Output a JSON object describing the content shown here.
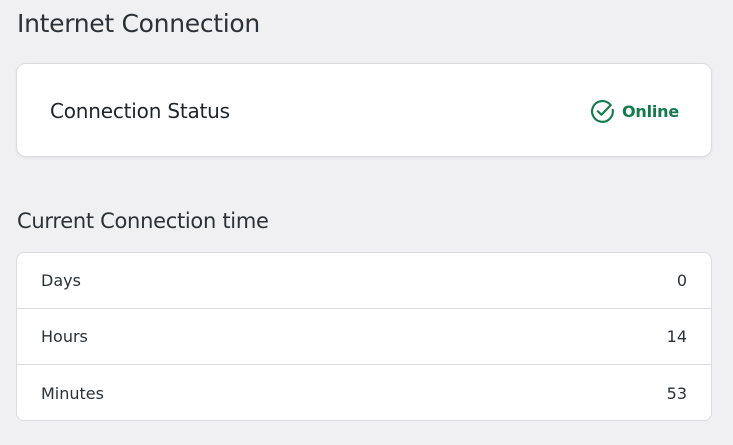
{
  "page": {
    "title": "Internet Connection"
  },
  "status_card": {
    "label": "Connection Status",
    "status_text": "Online",
    "status_icon": "check-circle-icon",
    "status_color": "#137a4c"
  },
  "connection_time": {
    "title": "Current Connection time",
    "rows": [
      {
        "label": "Days",
        "value": "0"
      },
      {
        "label": "Hours",
        "value": "14"
      },
      {
        "label": "Minutes",
        "value": "53"
      }
    ]
  },
  "colors": {
    "background": "#f0f0f2",
    "card": "#ffffff",
    "border": "#dcdce0",
    "text": "#2b3136",
    "online": "#137a4c"
  }
}
